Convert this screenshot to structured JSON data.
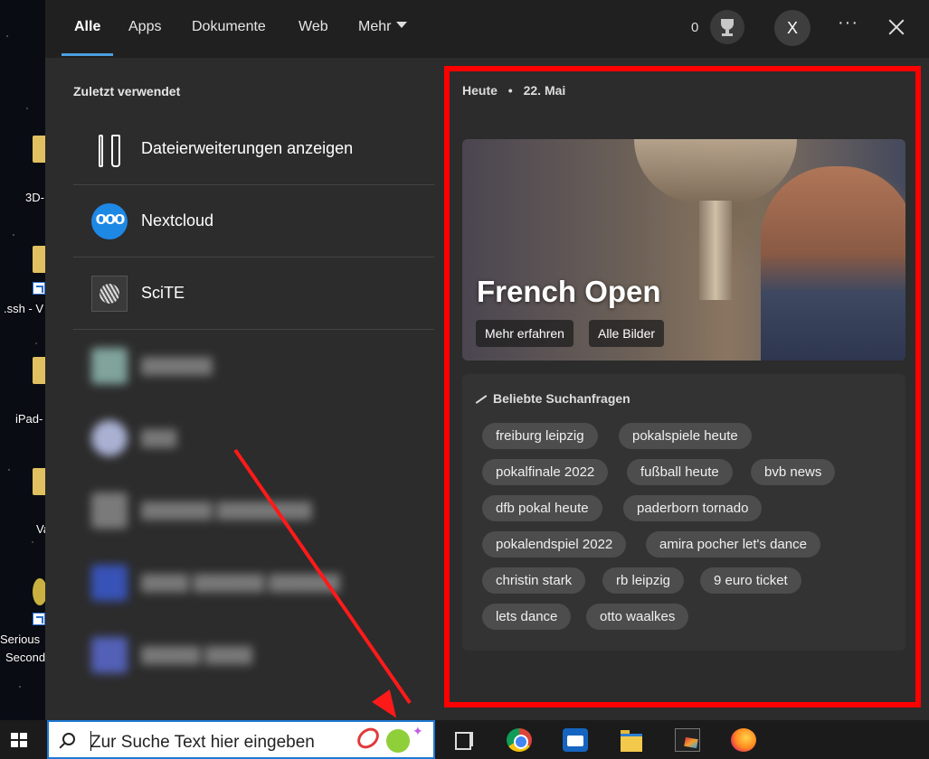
{
  "desktop": {
    "labels": [
      "3D-",
      ".ssh - V",
      "iPad-",
      "Va",
      "Serious",
      "Second"
    ]
  },
  "tabs": {
    "all": "Alle",
    "apps": "Apps",
    "docs": "Dokumente",
    "web": "Web",
    "more": "Mehr"
  },
  "header": {
    "points": "0",
    "avatar_initial": "X",
    "more_dots": "···"
  },
  "recent": {
    "title": "Zuletzt verwendet",
    "items": [
      {
        "label": "Dateierweiterungen anzeigen",
        "icon": "tools-icon"
      },
      {
        "label": "Nextcloud",
        "icon": "nextcloud-icon"
      },
      {
        "label": "SciTE",
        "icon": "scite-icon"
      },
      {
        "label": "▓▓▓▓▓▓",
        "icon": "blurred-icon"
      },
      {
        "label": "▓▓▓",
        "icon": "blurred-icon"
      },
      {
        "label": "▓▓▓▓▓▓ ▓▓▓▓▓▓▓▓",
        "icon": "blurred-icon"
      },
      {
        "label": "▓▓▓▓ ▓▓▓▓▓▓ ▓▓▓▓▓▓",
        "icon": "blurred-icon"
      },
      {
        "label": "▓▓▓▓▓ ▓▓▓▓",
        "icon": "blurred-icon"
      }
    ]
  },
  "today": {
    "label": "Heute",
    "separator": "•",
    "date": "22. Mai"
  },
  "hero": {
    "title": "French Open",
    "learn_more": "Mehr erfahren",
    "all_images": "Alle Bilder"
  },
  "trending": {
    "title": "Beliebte Suchanfragen",
    "chips": [
      "freiburg leipzig",
      "pokalspiele heute",
      "pokalfinale 2022",
      "fußball heute",
      "bvb news",
      "dfb pokal heute",
      "paderborn tornado",
      "pokalendspiel 2022",
      "amira pocher let's dance",
      "christin stark",
      "rb leipzig",
      "9 euro ticket",
      "lets dance",
      "otto waalkes"
    ]
  },
  "taskbar": {
    "search_placeholder": "Zur Suche Text hier eingeben"
  },
  "colors": {
    "accent": "#4ca0e0",
    "highlight_box": "#ff0000",
    "panel_bg": "#2c2c2c",
    "chip_bg": "#4d4d4d"
  }
}
